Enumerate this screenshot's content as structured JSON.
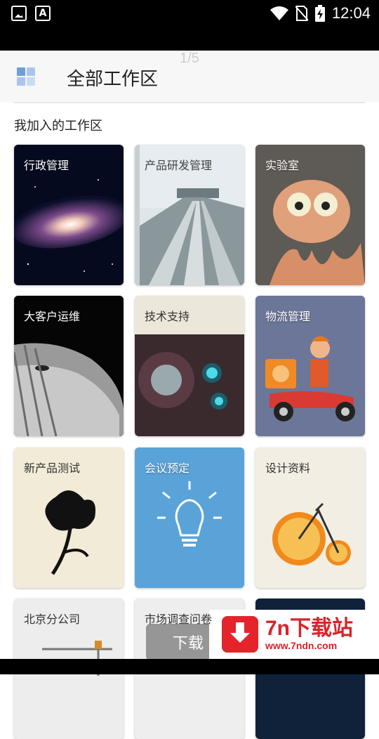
{
  "status_bar": {
    "time": "12:04",
    "icons": [
      "image-icon",
      "font-icon",
      "wifi-icon",
      "no-sim-icon",
      "battery-charging-icon"
    ]
  },
  "pager": "1/5",
  "header": {
    "title": "全部工作区",
    "icon": "grid-icon"
  },
  "section": {
    "title": "我加入的工作区"
  },
  "workspaces": [
    {
      "label": "行政管理",
      "image": "galaxy"
    },
    {
      "label": "产品研发管理",
      "image": "train-tracks"
    },
    {
      "label": "实验室",
      "image": "octopus"
    },
    {
      "label": "大客户运维",
      "image": "lion"
    },
    {
      "label": "技术支持",
      "image": "machine"
    },
    {
      "label": "物流管理",
      "image": "scooter-courier"
    },
    {
      "label": "新产品测试",
      "image": "ink-flower"
    },
    {
      "label": "会议预定",
      "image": "lightbulb"
    },
    {
      "label": "设计资料",
      "image": "orange-bicycle"
    },
    {
      "label": "北京分公司",
      "image": "crane"
    },
    {
      "label": "市场调查问卷",
      "image": "unknown"
    },
    {
      "label": "",
      "image": "dark"
    }
  ],
  "overlay": {
    "button_text": "下载",
    "brand": "7n下载站",
    "url": "www.7ndn.com"
  }
}
